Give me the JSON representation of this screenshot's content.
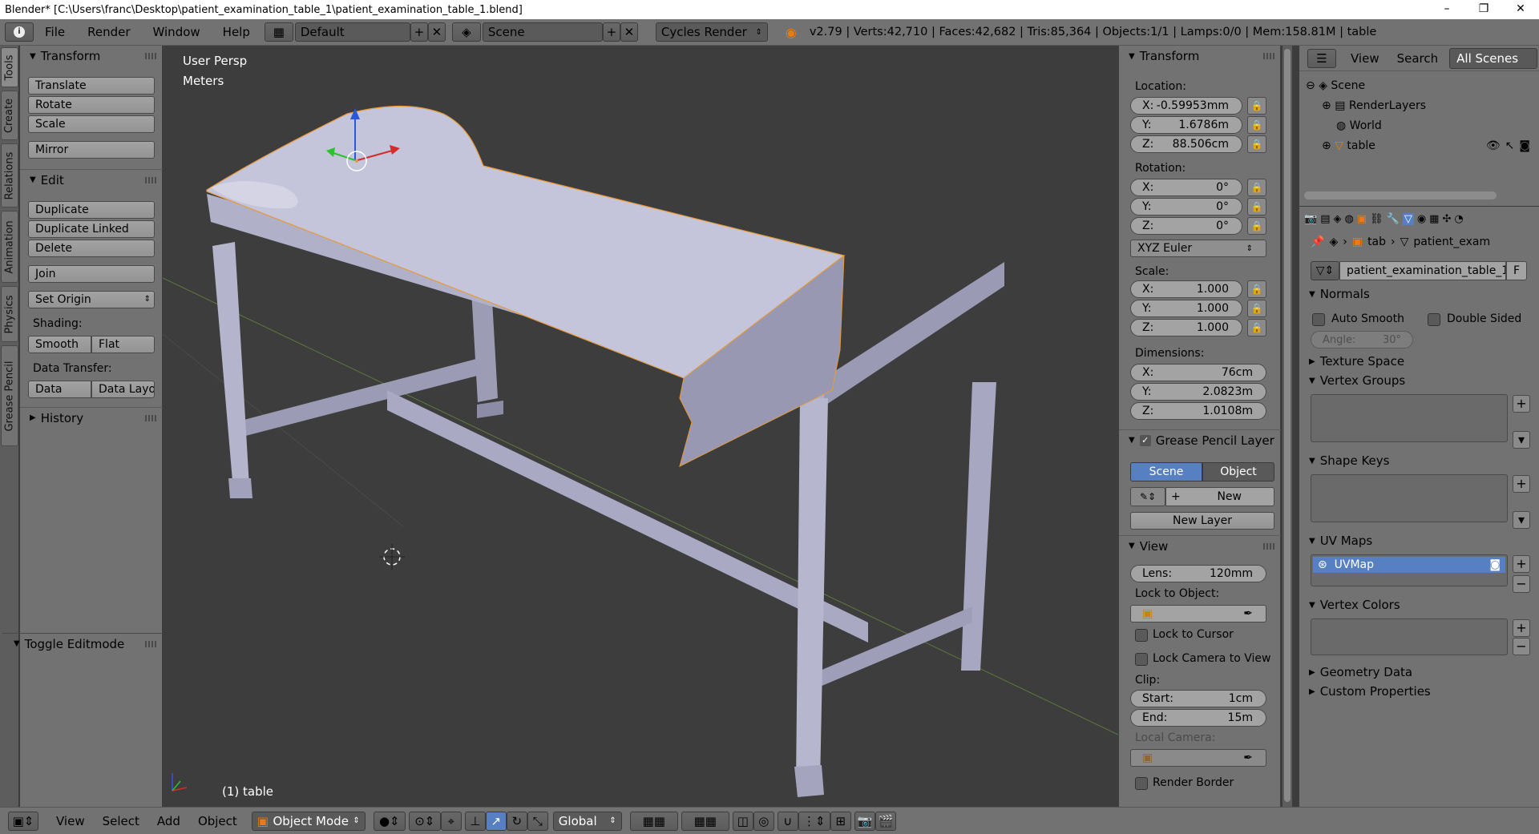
{
  "window": {
    "title": "Blender* [C:\\Users\\franc\\Desktop\\patient_examination_table_1\\patient_examination_table_1.blend]",
    "minimize": "–",
    "maximize": "❐",
    "close": "✕"
  },
  "infobar": {
    "menus": [
      "File",
      "Render",
      "Window",
      "Help"
    ],
    "layout": "Default",
    "scene": "Scene",
    "engine": "Cycles Render",
    "stats": "v2.79 | Verts:42,710 | Faces:42,682 | Tris:85,364 | Objects:1/1 | Lamps:0/0 | Mem:158.81M | table"
  },
  "left_tabs": [
    "Tools",
    "Create",
    "Relations",
    "Animation",
    "Physics",
    "Grease Pencil"
  ],
  "toolshelf": {
    "transform_header": "Transform",
    "translate": "Translate",
    "rotate": "Rotate",
    "scale": "Scale",
    "mirror": "Mirror",
    "edit_header": "Edit",
    "duplicate": "Duplicate",
    "duplicate_linked": "Duplicate Linked",
    "delete": "Delete",
    "join": "Join",
    "set_origin": "Set Origin",
    "shading_label": "Shading:",
    "smooth": "Smooth",
    "flat": "Flat",
    "data_transfer_label": "Data Transfer:",
    "data": "Data",
    "data_layout": "Data Layo",
    "history_header": "History",
    "toggle_editmode": "Toggle Editmode"
  },
  "viewport": {
    "view_name": "User Persp",
    "units": "Meters",
    "object_label": "(1) table"
  },
  "npanel": {
    "transform_header": "Transform",
    "location_label": "Location:",
    "loc_x_key": "X:",
    "loc_x": "-0.59953mm",
    "loc_y_key": "Y:",
    "loc_y": "1.6786m",
    "loc_z_key": "Z:",
    "loc_z": "88.506cm",
    "rotation_label": "Rotation:",
    "rot_x_key": "X:",
    "rot_x": "0°",
    "rot_y_key": "Y:",
    "rot_y": "0°",
    "rot_z_key": "Z:",
    "rot_z": "0°",
    "rotation_mode": "XYZ Euler",
    "scale_label": "Scale:",
    "scl_x_key": "X:",
    "scl_x": "1.000",
    "scl_y_key": "Y:",
    "scl_y": "1.000",
    "scl_z_key": "Z:",
    "scl_z": "1.000",
    "dimensions_label": "Dimensions:",
    "dim_x_key": "X:",
    "dim_x": "76cm",
    "dim_y_key": "Y:",
    "dim_y": "2.0823m",
    "dim_z_key": "Z:",
    "dim_z": "1.0108m",
    "grease_pencil_header": "Grease Pencil Layer",
    "gp_scene": "Scene",
    "gp_object": "Object",
    "gp_new": "New",
    "gp_new_layer": "New Layer",
    "view_header": "View",
    "lens_key": "Lens:",
    "lens": "120mm",
    "lock_to_object": "Lock to Object:",
    "lock_to_cursor": "Lock to Cursor",
    "lock_camera": "Lock Camera to View",
    "clip_label": "Clip:",
    "start_key": "Start:",
    "start": "1cm",
    "end_key": "End:",
    "end": "15m",
    "local_camera": "Local Camera:",
    "render_border": "Render Border"
  },
  "outliner": {
    "view": "View",
    "search": "Search",
    "filter": "All Scenes",
    "items": [
      "Scene",
      "RenderLayers",
      "World",
      "table"
    ]
  },
  "properties": {
    "breadcrumb_obj": "tab",
    "breadcrumb_mesh": "patient_exam",
    "mesh_name": "patient_examination_table_1",
    "fake_user": "F",
    "normals_header": "Normals",
    "auto_smooth": "Auto Smooth",
    "double_sided": "Double Sided",
    "angle_key": "Angle:",
    "angle": "30°",
    "texture_space": "Texture Space",
    "vertex_groups": "Vertex Groups",
    "shape_keys": "Shape Keys",
    "uv_maps": "UV Maps",
    "uvmap_item": "UVMap",
    "vertex_colors": "Vertex Colors",
    "geometry_data": "Geometry Data",
    "custom_properties": "Custom Properties"
  },
  "bottombar": {
    "view": "View",
    "select": "Select",
    "add": "Add",
    "object": "Object",
    "mode": "Object Mode",
    "orientation": "Global"
  },
  "colors": {
    "accent_blue": "#5680c2",
    "panel_gray": "#727272",
    "viewport_bg": "#3d3d3d"
  }
}
